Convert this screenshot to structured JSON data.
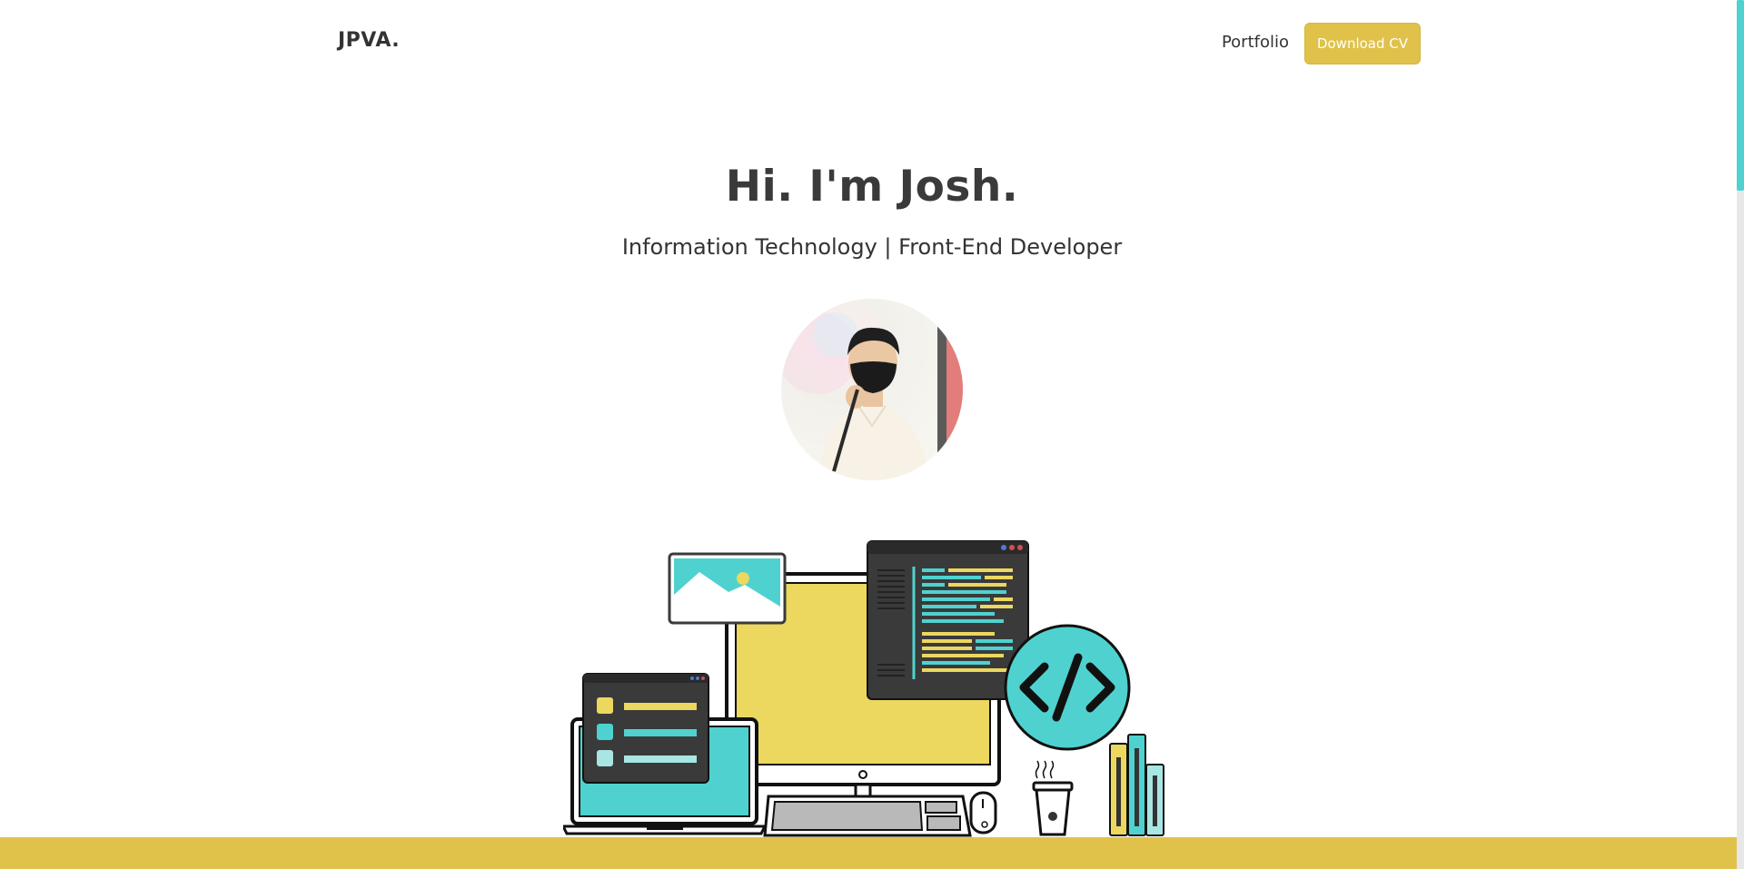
{
  "nav": {
    "logo": "JPVA.",
    "portfolio_link": "Portfolio",
    "download_cv_label": "Download CV"
  },
  "hero": {
    "title": "Hi. I'm Josh.",
    "subtitle": "Information Technology | Front-End Developer"
  },
  "colors": {
    "accent_yellow": "#e0c24a",
    "accent_teal": "#4fd2cf",
    "dark": "#3d3d3d"
  },
  "icons": {
    "code": "code-icon",
    "image": "image-icon",
    "coffee": "coffee-cup-icon"
  }
}
